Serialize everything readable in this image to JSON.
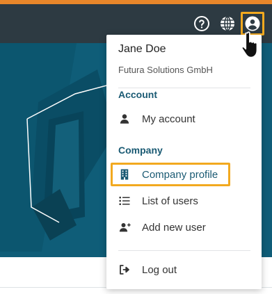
{
  "header": {
    "icons": [
      "help-icon",
      "globe-icon",
      "user-icon"
    ]
  },
  "menu": {
    "user_name": "Jane Doe",
    "company_name": "Futura Solutions GmbH",
    "account_section": {
      "title": "Account",
      "items": [
        {
          "label": "My account",
          "icon": "person-icon"
        }
      ]
    },
    "company_section": {
      "title": "Company",
      "items": [
        {
          "label": "Company profile",
          "icon": "building-icon",
          "highlighted": true
        },
        {
          "label": "List of users",
          "icon": "list-icon"
        },
        {
          "label": "Add new user",
          "icon": "add-user-icon"
        }
      ]
    },
    "logout": {
      "label": "Log out",
      "icon": "logout-icon"
    }
  },
  "colors": {
    "header_bg": "#2d3a42",
    "top_accent": "#e8862a",
    "banner_bg": "#0f5d78",
    "section_title": "#1a5a73",
    "highlight_border": "#f2a91f"
  }
}
